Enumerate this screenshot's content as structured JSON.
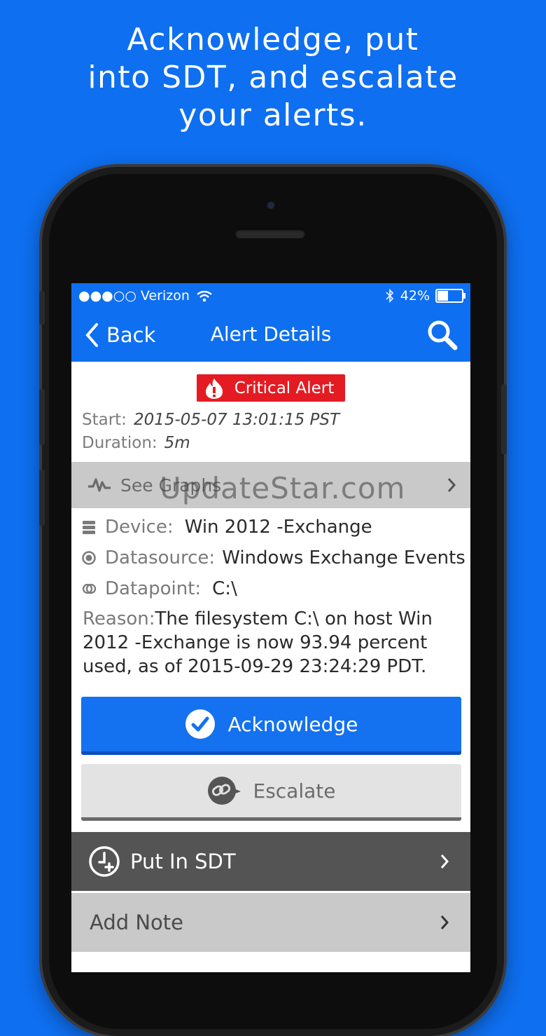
{
  "headline": {
    "line1": "Acknowledge, put",
    "line2": "into SDT, and escalate",
    "line3": "your alerts."
  },
  "status_bar": {
    "carrier": "●●●○○ Verizon",
    "battery": "42%",
    "battery_level": 0.42
  },
  "nav": {
    "back_label": "Back",
    "title": "Alert Details"
  },
  "alert": {
    "badge_label": "Critical Alert",
    "start_label": "Start:",
    "start_value": "2015-05-07 13:01:15 PST",
    "duration_label": "Duration:",
    "duration_value": "5m"
  },
  "graphs": {
    "label": "See Graphs"
  },
  "details": {
    "device_label": "Device:",
    "device_value": "Win 2012 -Exchange",
    "datasource_label": "Datasource:",
    "datasource_value": "Windows Exchange Events",
    "datapoint_label": "Datapoint:",
    "datapoint_value": "C:\\",
    "reason_label": "Reason:",
    "reason_value": "The filesystem C:\\ on host Win 2012 -Exchange is now 93.94 percent used, as of 2015-09-29 23:24:29 PDT."
  },
  "actions": {
    "acknowledge": "Acknowledge",
    "escalate": "Escalate",
    "sdt": "Put In SDT",
    "add_note": "Add Note"
  },
  "watermark": "UpdateStar.com",
  "colors": {
    "brand_blue": "#0e6ff0",
    "critical_red": "#e41b23"
  }
}
